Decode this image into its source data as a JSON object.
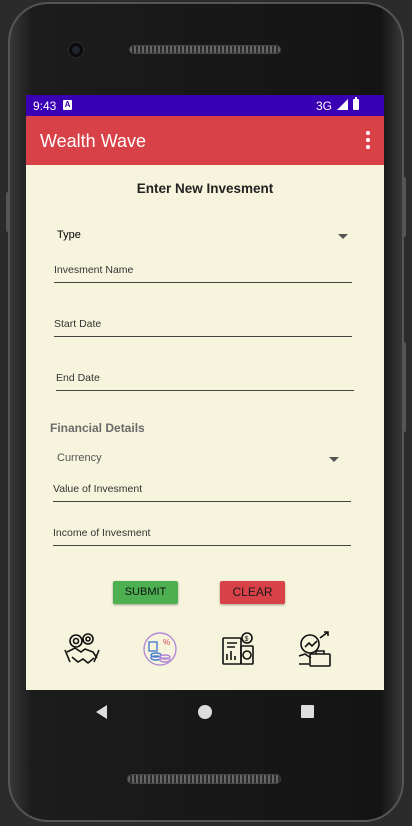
{
  "status_bar": {
    "time": "9:43",
    "notification_icon": "A",
    "network": "3G"
  },
  "app_bar": {
    "title": "Wealth Wave",
    "menu_icon": "overflow-menu-icon"
  },
  "form": {
    "title": "Enter New Invesment",
    "type_select": "Type",
    "name_hint": "Invesment Name",
    "start_date_hint": "Start Date",
    "end_date_hint": "End Date"
  },
  "financial": {
    "section_label": "Financial Details",
    "currency_select": "Currency",
    "value_hint": "Value of Invesment",
    "income_hint": "Income of Invesment"
  },
  "buttons": {
    "submit": "SUBMIT",
    "clear": "CLEAR"
  },
  "bottom_icons": [
    "handshake-gears-icon",
    "percentage-coins-icon",
    "financial-report-icon",
    "investment-growth-icon"
  ],
  "colors": {
    "app_bar": "#d94148",
    "status_bar": "#3a00b3",
    "background": "#f6f4dc",
    "submit": "#4caf50",
    "clear": "#d94148"
  }
}
